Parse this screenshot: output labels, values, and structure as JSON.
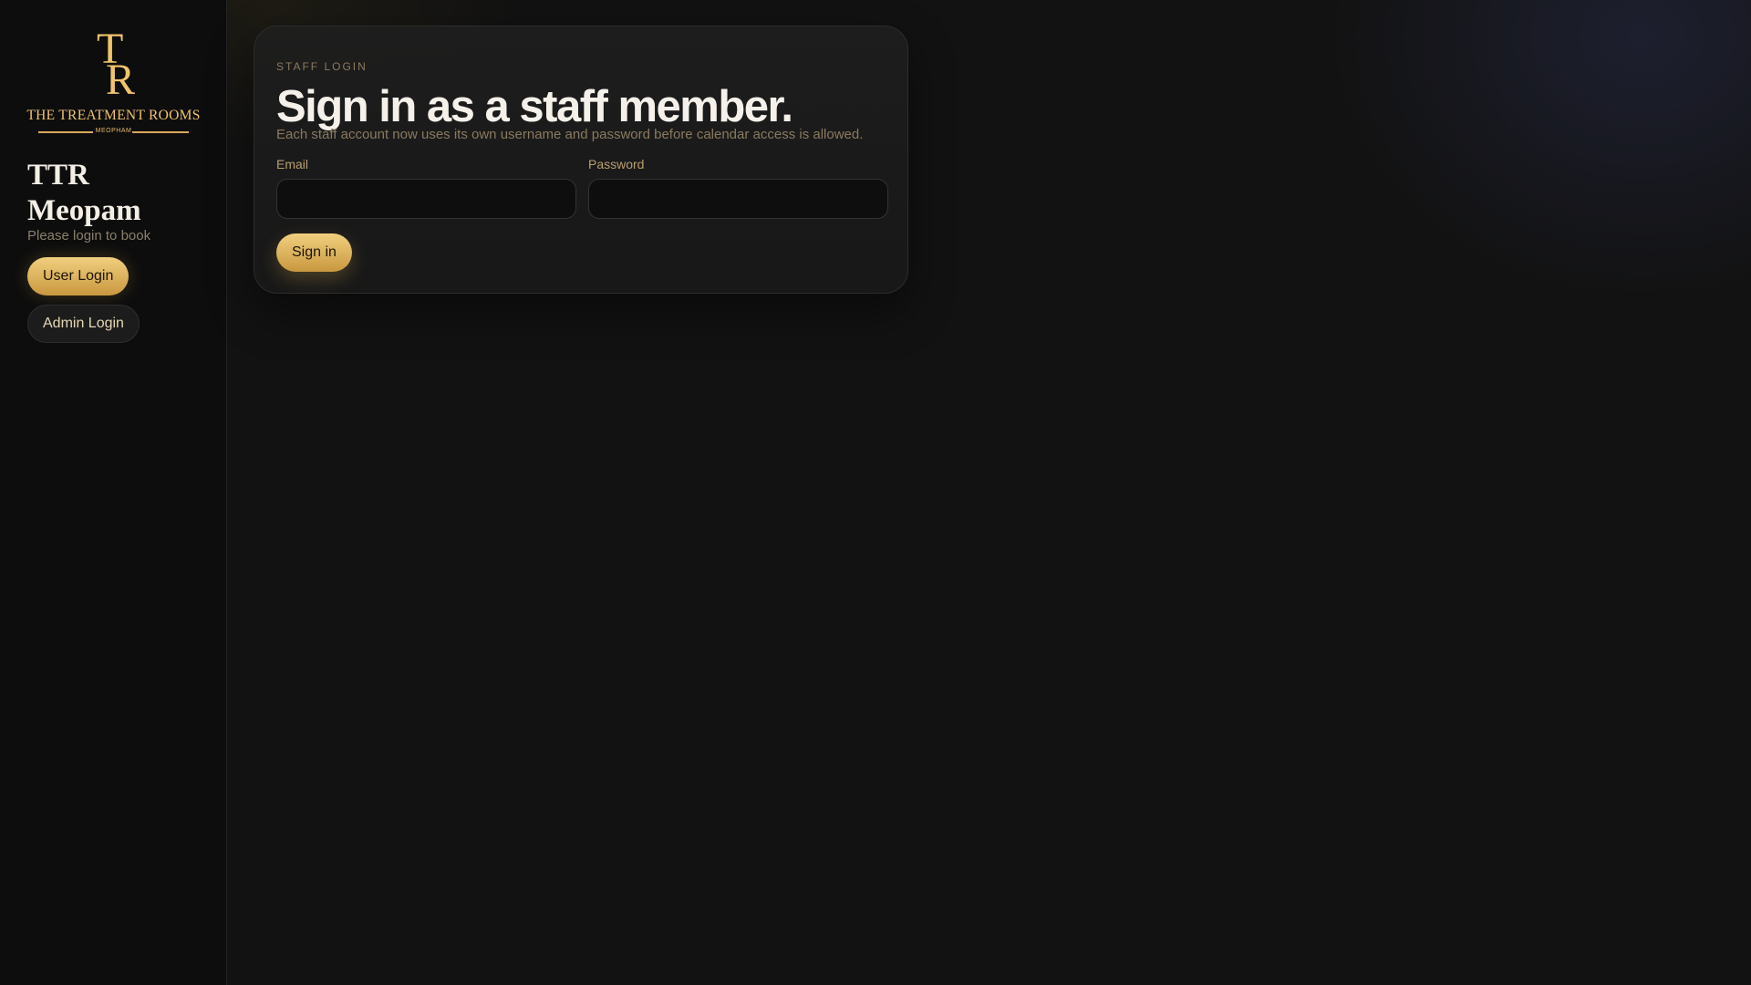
{
  "sidebar": {
    "logo": {
      "monogram_t": "T",
      "monogram_r": "R",
      "name": "THE TREATMENT ROOMS",
      "location": "MEOPHAM"
    },
    "title": "TTR\nMeopam",
    "subtitle": "Please login to book",
    "user_login_label": "User Login",
    "admin_login_label": "Admin Login"
  },
  "login_card": {
    "eyebrow": "STAFF LOGIN",
    "title": "Sign in as a staff member.",
    "description": "Each staff account now uses its own username and password before calendar access is allowed.",
    "email_label": "Email",
    "email_value": "",
    "email_placeholder": "",
    "password_label": "Password",
    "password_value": "",
    "password_placeholder": "",
    "submit_label": "Sign in"
  },
  "colors": {
    "accent_gold": "#f1c46c",
    "background": "#121212",
    "sidebar_background": "#0d0d0d",
    "muted_text": "#8a7a5f"
  }
}
